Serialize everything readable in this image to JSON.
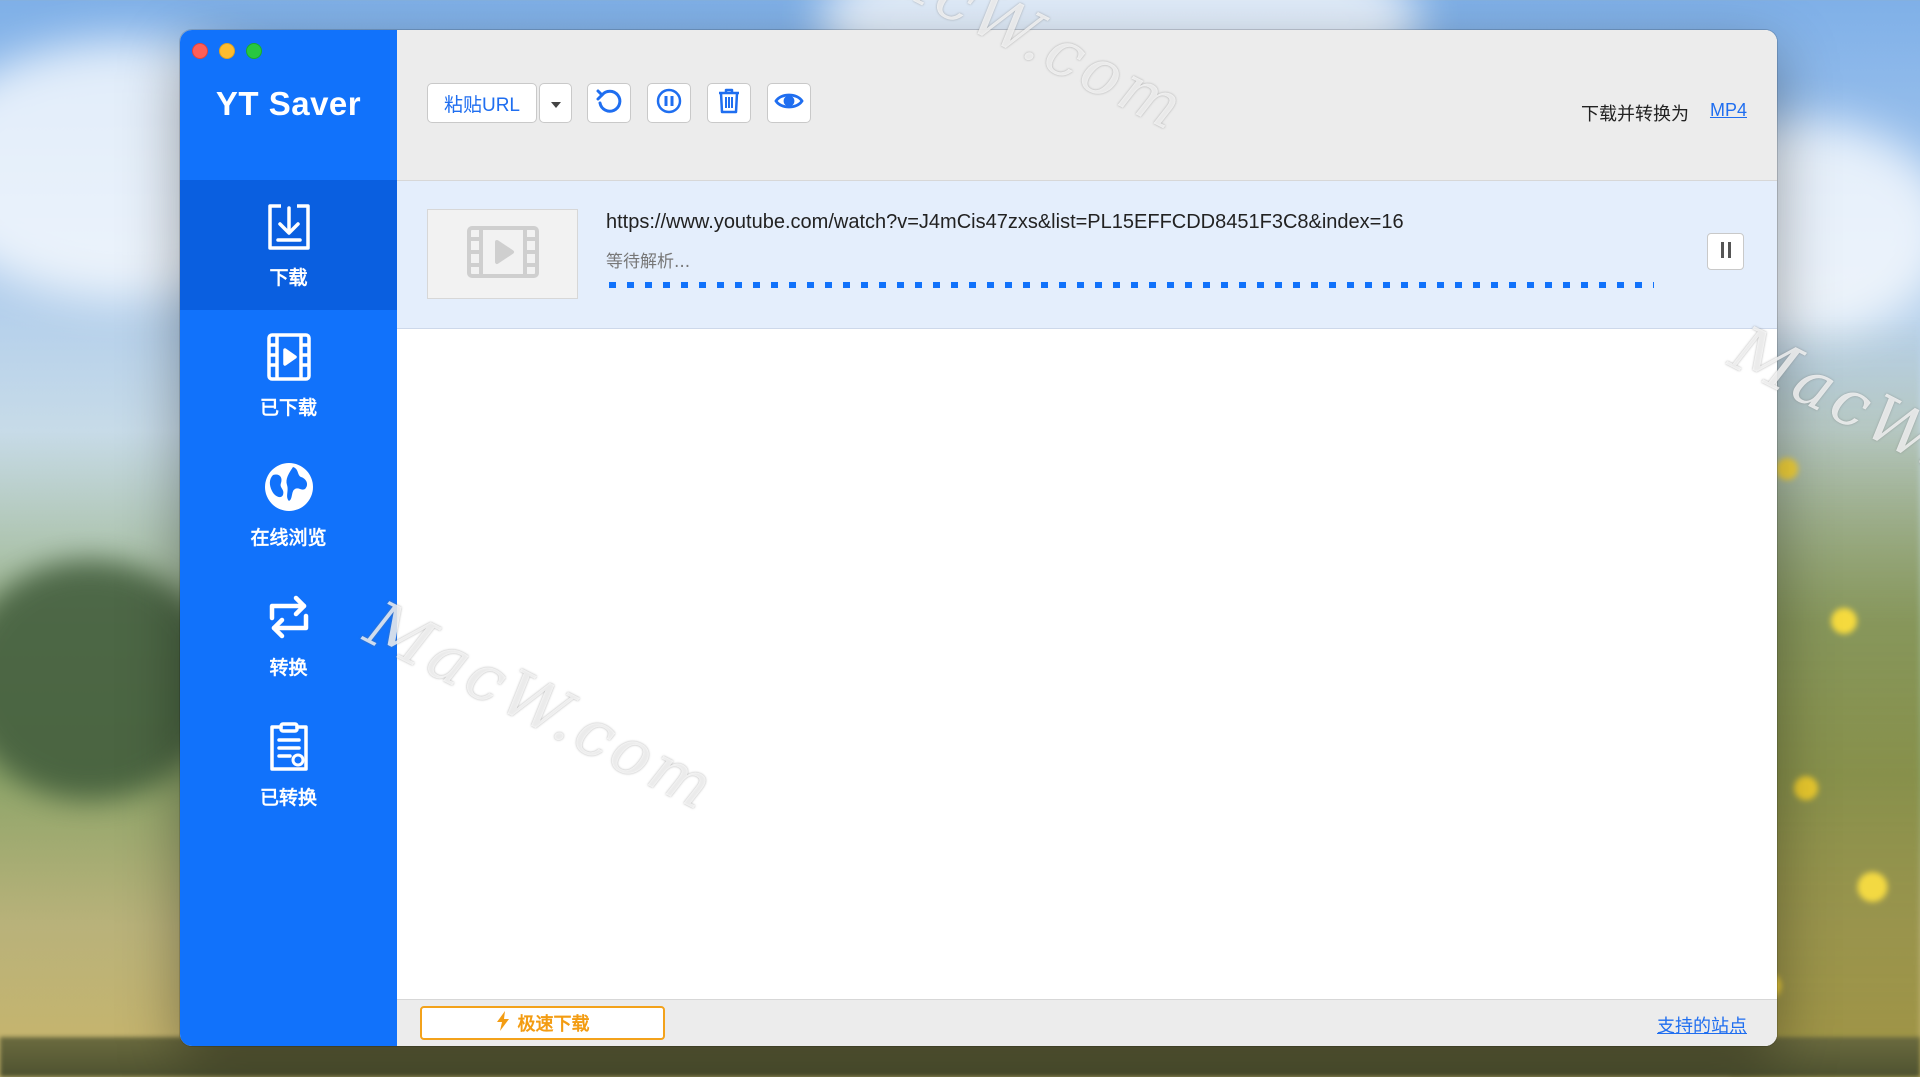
{
  "window": {
    "app_title": "YT Saver"
  },
  "sidebar": {
    "items": [
      {
        "label": "下载",
        "icon": "download-icon",
        "active": true
      },
      {
        "label": "已下载",
        "icon": "film-icon",
        "active": false
      },
      {
        "label": "在线浏览",
        "icon": "globe-icon",
        "active": false
      },
      {
        "label": "转换",
        "icon": "convert-icon",
        "active": false
      },
      {
        "label": "已转换",
        "icon": "converted-list-icon",
        "active": false
      }
    ]
  },
  "toolbar": {
    "paste_label": "粘贴URL",
    "icons": [
      "dropdown-arrow-icon",
      "refresh-icon",
      "pause-all-icon",
      "trash-icon",
      "eye-icon"
    ],
    "convert_text": "下载并转换为",
    "convert_format": "MP4"
  },
  "tasks": [
    {
      "url": "https://www.youtube.com/watch?v=J4mCis47zxs&list=PL15EFFCDD8451F3C8&index=16",
      "status": "等待解析...",
      "thumbnail_icon": "video-placeholder-icon",
      "action_icon": "pause-icon"
    }
  ],
  "bottom": {
    "fast_download_label": "极速下载",
    "fast_download_icon": "lightning-icon",
    "supported_sites_label": "支持的站点"
  },
  "watermark": {
    "text": "MacW.com"
  },
  "colors": {
    "sidebar": "#1172fb",
    "sidebar_active": "#0a5fe0",
    "accent": "#1f6ef0",
    "orange": "#f39c12"
  }
}
